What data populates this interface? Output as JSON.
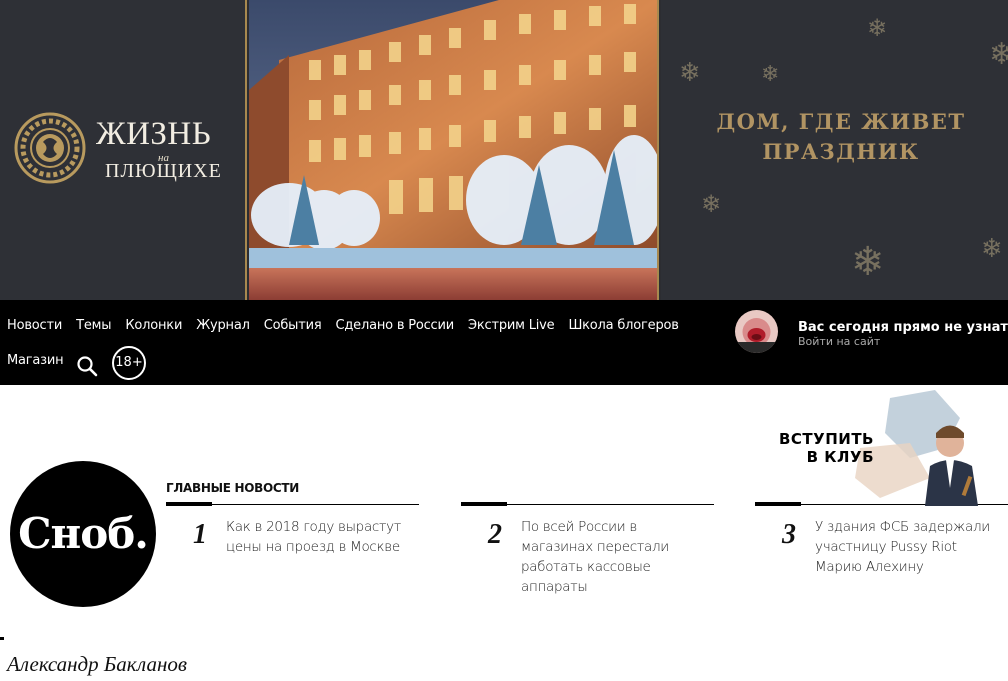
{
  "banner": {
    "logo_line1": "ЖИЗНЬ",
    "logo_small": "на",
    "logo_line2": "ПЛЮЩИХЕ",
    "slogan_line1": "ДОМ, ГДЕ ЖИВЕТ",
    "slogan_line2": "ПРАЗДНИК",
    "accent_color": "#a8894f"
  },
  "nav": {
    "items": [
      "Новости",
      "Темы",
      "Колонки",
      "Журнал",
      "События",
      "Сделано в России",
      "Экстрим Live",
      "Школа блогеров"
    ],
    "shop": "Магазин",
    "age_rating": "18+",
    "user_title": "Вас сегодня прямо не узнать",
    "login_link": "Войти на сайт"
  },
  "main": {
    "logo_text": "Сноб.",
    "section_title": "ГЛАВНЫЕ НОВОСТИ",
    "news": [
      {
        "num": "1",
        "text": "Как в 2018 году вырастут цены на проезд в Москве"
      },
      {
        "num": "2",
        "text": "По всей России в магазинах перестали работать кассовые аппараты"
      },
      {
        "num": "3",
        "text": "У здания ФСБ задержали участницу Pussy Riot Марию Алехину"
      }
    ],
    "club_cta": "ВСТУПИТЬ В КЛУБ",
    "author": "Александр Бакланов"
  }
}
